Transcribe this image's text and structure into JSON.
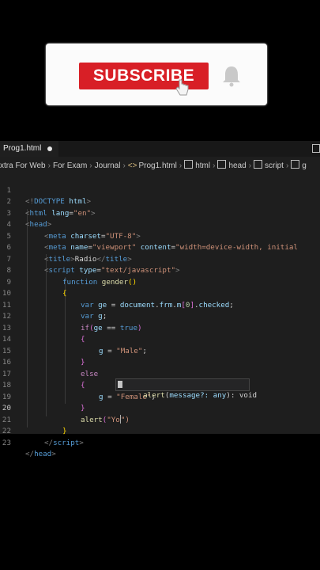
{
  "banner": {
    "subscribe_label": "SUBSCRIBE"
  },
  "editor": {
    "tab": {
      "label": "Prog1.html"
    },
    "breadcrumb": {
      "items": [
        "xtra For Web",
        "For Exam",
        "Journal",
        "Prog1.html",
        "html",
        "head",
        "script",
        "g"
      ]
    },
    "line_numbers": [
      "1",
      "2",
      "3",
      "4",
      "5",
      "6",
      "7",
      "8",
      "9",
      "10",
      "11",
      "12",
      "13",
      "14",
      "15",
      "16",
      "17",
      "18",
      "19",
      "20",
      "21",
      "22",
      "23"
    ],
    "code": {
      "l1a": "<!",
      "l1b": "DOCTYPE",
      "l1c": " html",
      "l1d": ">",
      "l2a": "<",
      "l2b": "html",
      "l2c": " lang",
      "l2d": "=",
      "l2e": "\"en\"",
      "l2f": ">",
      "l3a": "<",
      "l3b": "head",
      "l3c": ">",
      "l4a": "<",
      "l4b": "meta",
      "l4c": " charset",
      "l4d": "=",
      "l4e": "\"UTF-8\"",
      "l4f": ">",
      "l5a": "<",
      "l5b": "meta",
      "l5c": " name",
      "l5d": "=",
      "l5e": "\"viewport\"",
      "l5f": " content",
      "l5g": "=",
      "l5h": "\"width=device-width, initial",
      "l6a": "<",
      "l6b": "title",
      "l6c": ">",
      "l6d": "Radio",
      "l6e": "</",
      "l6f": "title",
      "l6g": ">",
      "l7a": "<",
      "l7b": "script",
      "l7c": " type",
      "l7d": "=",
      "l7e": "\"text/javascript\"",
      "l7f": ">",
      "l8a": "function",
      "l8b": " gender",
      "l8c": "()",
      "l9a": "{",
      "l10a": "var",
      "l10b": " ge",
      "l10c": " = ",
      "l10d": "document",
      "l10e": ".",
      "l10f": "frm",
      "l10g": ".",
      "l10h": "m",
      "l10i": "[",
      "l10j": "0",
      "l10k": "]",
      "l10l": ".",
      "l10m": "checked",
      "l10n": ";",
      "l11a": "var",
      "l11b": " g",
      "l11c": ";",
      "l12a": "if",
      "l12b": "(",
      "l12c": "ge",
      "l12d": " == ",
      "l12e": "true",
      "l12f": ")",
      "l13a": "{",
      "l14a": "g",
      "l14b": " = ",
      "l14c": "\"Male\"",
      "l14d": ";",
      "l15a": "}",
      "l16a": "else",
      "l17a": "{",
      "l18a": "g",
      "l18b": " = ",
      "l18c": "\"Female\"",
      "l18d": ";",
      "l19a": "}",
      "l20a": "alert",
      "l20b": "(",
      "l20c": "\"Yo",
      "l20d": "\")",
      "l21a": "}",
      "l22a": "</",
      "l22b": "script",
      "l22c": ">",
      "l23a": "</",
      "l23b": "head",
      "l23c": ">"
    },
    "tooltip": {
      "fn": "alert",
      "open": "(",
      "param": "message?: any",
      "close": "): void"
    }
  }
}
